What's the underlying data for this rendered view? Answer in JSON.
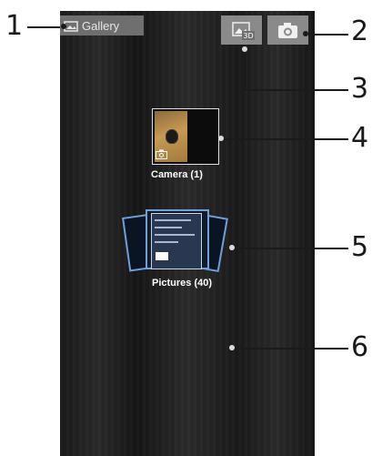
{
  "screen": {
    "title": "Gallery",
    "buttons": {
      "view_3d": "3D"
    },
    "albums": [
      {
        "label": "Camera  (1)"
      },
      {
        "label": "Pictures  (40)"
      }
    ]
  },
  "callouts": [
    "1",
    "2",
    "3",
    "4",
    "5",
    "6"
  ],
  "icons": [
    "gallery-icon",
    "view-3d-icon",
    "camera-icon",
    "camera-badge-icon",
    "folder-icon"
  ]
}
